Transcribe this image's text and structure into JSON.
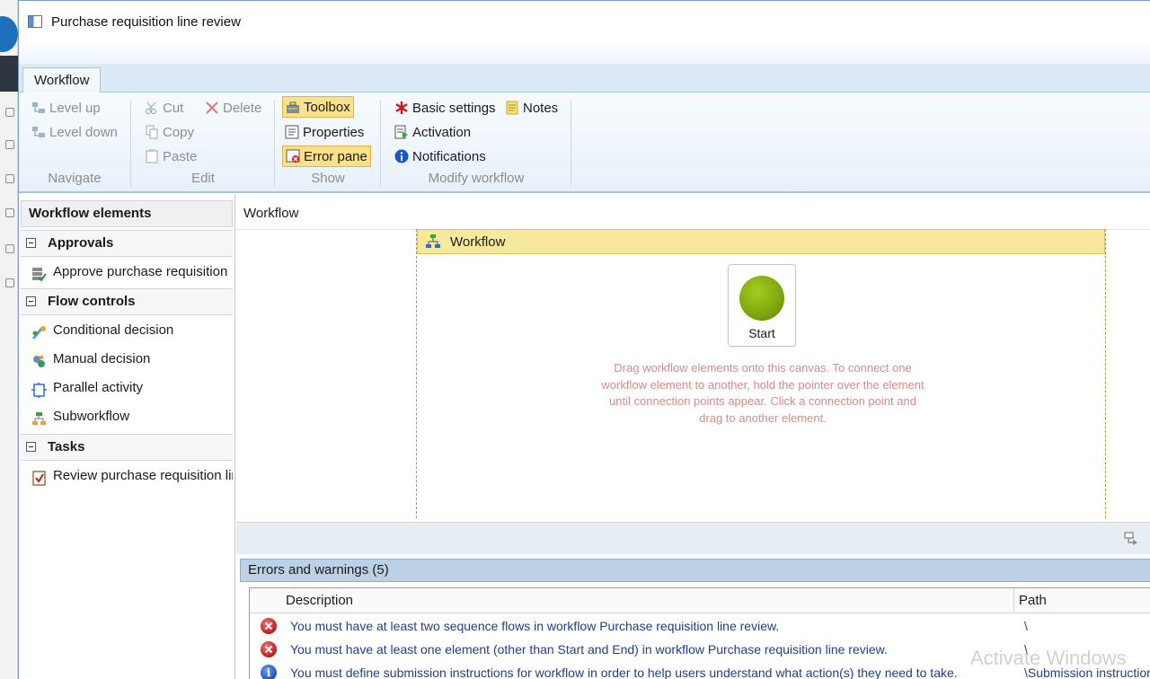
{
  "window": {
    "title": "Purchase requisition line review"
  },
  "ribbon": {
    "tab": "Workflow",
    "groups": {
      "navigate": {
        "label": "Navigate",
        "level_up": "Level up",
        "level_down": "Level down"
      },
      "edit": {
        "label": "Edit",
        "cut": "Cut",
        "delete": "Delete",
        "copy": "Copy",
        "paste": "Paste"
      },
      "show": {
        "label": "Show",
        "toolbox": "Toolbox",
        "properties": "Properties",
        "error_pane": "Error pane"
      },
      "modify": {
        "label": "Modify workflow",
        "basic_settings": "Basic settings",
        "notes": "Notes",
        "activation": "Activation",
        "notifications": "Notifications"
      }
    }
  },
  "toolbox": {
    "header": "Workflow elements",
    "sections": [
      {
        "label": "Approvals",
        "items": [
          "Approve purchase requisition"
        ]
      },
      {
        "label": "Flow controls",
        "items": [
          "Conditional decision",
          "Manual decision",
          "Parallel activity",
          "Subworkflow"
        ]
      },
      {
        "label": "Tasks",
        "items": [
          "Review purchase requisition line"
        ]
      }
    ]
  },
  "main": {
    "breadcrumb": "Workflow",
    "canvas_title": "Workflow",
    "start_label": "Start",
    "hint": "Drag workflow elements onto this canvas. To connect one workflow element to another, hold the pointer over the element until connection points appear.  Click a connection point and drag to another element."
  },
  "errors": {
    "header": "Errors and warnings (5)",
    "columns": {
      "description": "Description",
      "path": "Path"
    },
    "rows": [
      {
        "type": "error",
        "description": "You must have at least two sequence flows in workflow Purchase requisition line review.",
        "path": "\\"
      },
      {
        "type": "error",
        "description": "You must have at least one element (other than Start and End) in workflow Purchase requisition line review.",
        "path": "\\"
      },
      {
        "type": "info",
        "description": "You must define submission instructions for workflow  in order to help users understand what action(s) they need to take.",
        "path": "\\Submission instructions"
      }
    ]
  },
  "watermark": "Activate Windows",
  "colors": {
    "canvas_header": "#f6e99b",
    "active_button": "#fbe18a",
    "error_header": "#bcd1e6",
    "start_node": "#7ea50c"
  }
}
